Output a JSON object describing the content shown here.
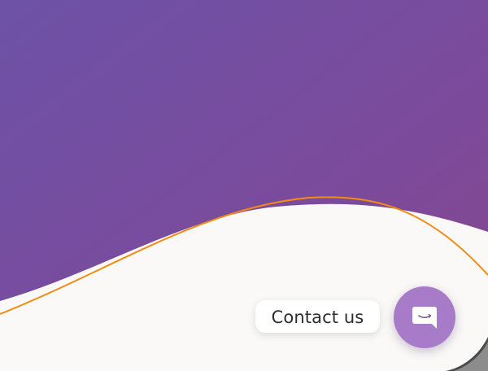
{
  "hero": {
    "gradient_start": "#6d52a6",
    "gradient_end": "#87478e",
    "wave_color": "#faf9f7",
    "accent_line_color": "#f08c14"
  },
  "contact": {
    "label": "Contact us"
  },
  "chat_button": {
    "icon": "chat-bubble-icon",
    "bg_color": "#a77bc8",
    "icon_color": "#ffffff"
  }
}
